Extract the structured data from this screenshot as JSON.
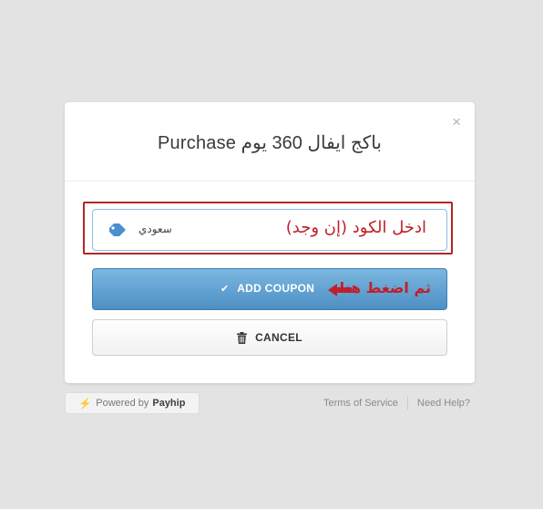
{
  "modal": {
    "title": "باكج ايفال 360 يوم Purchase",
    "close_label": "×"
  },
  "coupon": {
    "value": "سعودي",
    "annotation": "ادخل الكود (إن وجد)"
  },
  "buttons": {
    "add_coupon": "ADD COUPON",
    "add_annotation": "ثم اضغط هنا",
    "cancel": "CANCEL"
  },
  "footer": {
    "powered_prefix": "Powered by",
    "powered_brand": "Payhip",
    "links": [
      "Terms of Service",
      "Need Help?"
    ]
  },
  "colors": {
    "background": "#e3e3e3",
    "accent_blue": "#5a9bd0",
    "annotation_red": "#c0202a",
    "tag_icon": "#4a8fcf"
  },
  "icons": {
    "close": "close-icon",
    "tag": "tag-icon",
    "check": "check-icon",
    "arrow": "arrow-left-icon",
    "trash": "trash-icon",
    "bolt": "bolt-icon"
  }
}
